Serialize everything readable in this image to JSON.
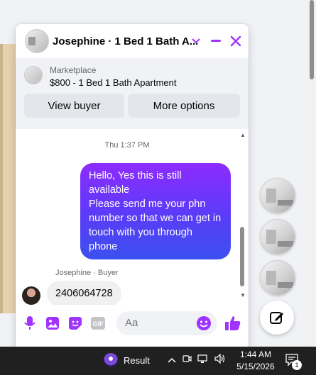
{
  "header": {
    "title": "Josephine · 1 Bed 1 Bath A...",
    "icons": {
      "dropdown": "chevron-down-icon",
      "minimize": "minimize-icon",
      "close": "close-icon"
    },
    "accent_color": "#a033ff"
  },
  "marketplace": {
    "label": "Marketplace",
    "listing": "$800 - 1 Bed 1 Bath Apartment",
    "view_buyer": "View buyer",
    "more_options": "More options"
  },
  "messages": {
    "timestamp": "Thu 1:37 PM",
    "outgoing": "Hello, Yes this is still available\nPlease send me your phn number so that we can get in touch with you through phone",
    "incoming_sender": "Josephine · Buyer",
    "incoming": "2406064728"
  },
  "composer": {
    "placeholder": "Aa",
    "icons": [
      "microphone-icon",
      "photo-icon",
      "sticker-icon",
      "gif-icon",
      "emoji-icon",
      "thumbs-up-icon"
    ],
    "gif_label": "GIF"
  },
  "taskbar": {
    "app_label": "Result",
    "time": "1:44 AM",
    "date": "5/15/2026",
    "notification_count": "1"
  }
}
